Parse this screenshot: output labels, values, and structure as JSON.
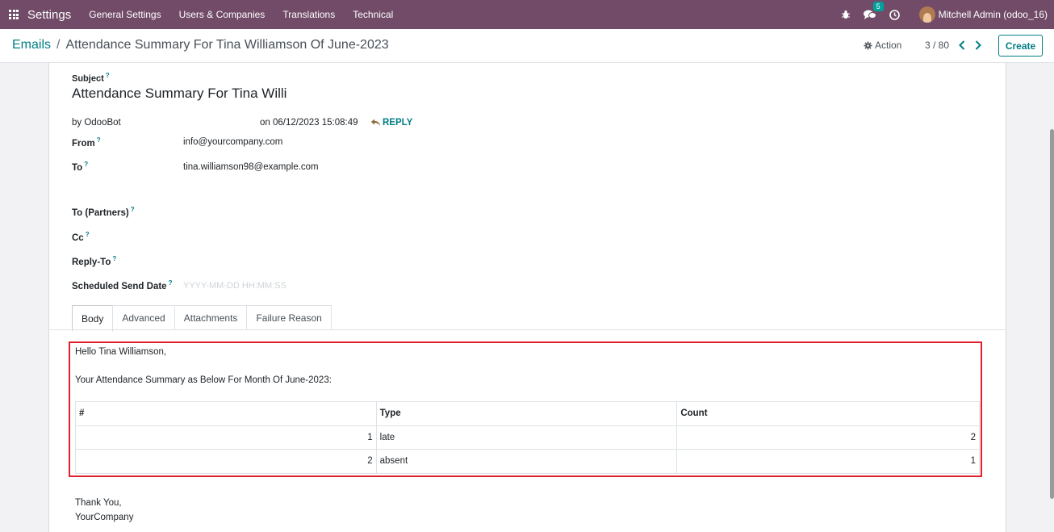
{
  "navbar": {
    "app_title": "Settings",
    "menu": [
      "General Settings",
      "Users & Companies",
      "Translations",
      "Technical"
    ],
    "message_count": "5",
    "user_name": "Mitchell Admin (odoo_16)",
    "accent_color": "#714b67"
  },
  "control_panel": {
    "breadcrumb_parent": "Emails",
    "breadcrumb_separator": "/",
    "breadcrumb_current": "Attendance Summary For Tina Williamson Of June-2023",
    "action_label": "Action",
    "pager": "3 / 80",
    "create_label": "Create"
  },
  "form": {
    "subject_label": "Subject",
    "subject_value": "Attendance Summary For Tina Willi",
    "author": "by OdooBot",
    "date": "on 06/12/2023 15:08:49",
    "reply_label": "REPLY",
    "help_mark": "?",
    "from_label": "From",
    "from_value": "info@yourcompany.com",
    "to_label": "To",
    "to_value": "tina.williamson98@example.com",
    "to_partners_label": "To (Partners)",
    "cc_label": "Cc",
    "reply_to_label": "Reply-To",
    "scheduled_label": "Scheduled Send Date",
    "scheduled_placeholder": "YYYY-MM-DD HH:MM:SS"
  },
  "tabs": [
    "Body",
    "Advanced",
    "Attachments",
    "Failure Reason"
  ],
  "body": {
    "greeting": "Hello Tina Williamson,",
    "intro": "Your Attendance Summary as Below For Month Of June-2023:",
    "table": {
      "headers": [
        "#",
        "Type",
        "Count"
      ],
      "rows": [
        [
          "1",
          "late",
          "2"
        ],
        [
          "2",
          "absent",
          "1"
        ]
      ]
    },
    "closing_1": "Thank You,",
    "closing_2": "YourCompany"
  }
}
